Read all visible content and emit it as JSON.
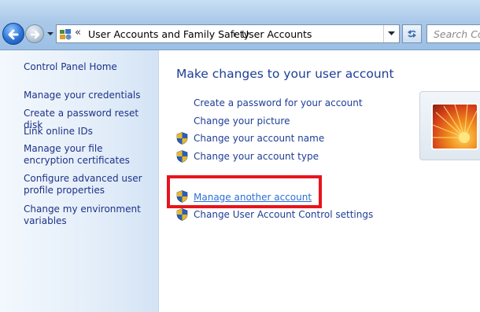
{
  "address": {
    "crumb1": "User Accounts and Family Safety",
    "crumb2": "User Accounts",
    "chevrons": "«"
  },
  "search": {
    "placeholder": "Search Con"
  },
  "sidebar": {
    "items": [
      {
        "label": "Control Panel Home"
      },
      {
        "label": "Manage your credentials"
      },
      {
        "label": "Create a password reset disk"
      },
      {
        "label": "Link online IDs"
      },
      {
        "label": "Manage your file encryption certificates"
      },
      {
        "label": "Configure advanced user profile properties"
      },
      {
        "label": "Change my environment variables"
      }
    ]
  },
  "main": {
    "title": "Make changes to your user account",
    "tasks": [
      {
        "label": "Create a password for your account",
        "shield": false
      },
      {
        "label": "Change your picture",
        "shield": false
      },
      {
        "label": "Change your account name",
        "shield": true
      },
      {
        "label": "Change your account type",
        "shield": true
      },
      {
        "label": "Manage another account",
        "shield": true
      },
      {
        "label": "Change User Account Control settings",
        "shield": true
      }
    ]
  },
  "colors": {
    "link": "#1e3e96",
    "highlight": "#e8141b",
    "sidebar_bg": "#e4eef9"
  },
  "icons": [
    "back-arrow-icon",
    "forward-arrow-icon",
    "control-panel-icon",
    "refresh-icon",
    "uac-shield-icon",
    "user-picture-flower"
  ]
}
